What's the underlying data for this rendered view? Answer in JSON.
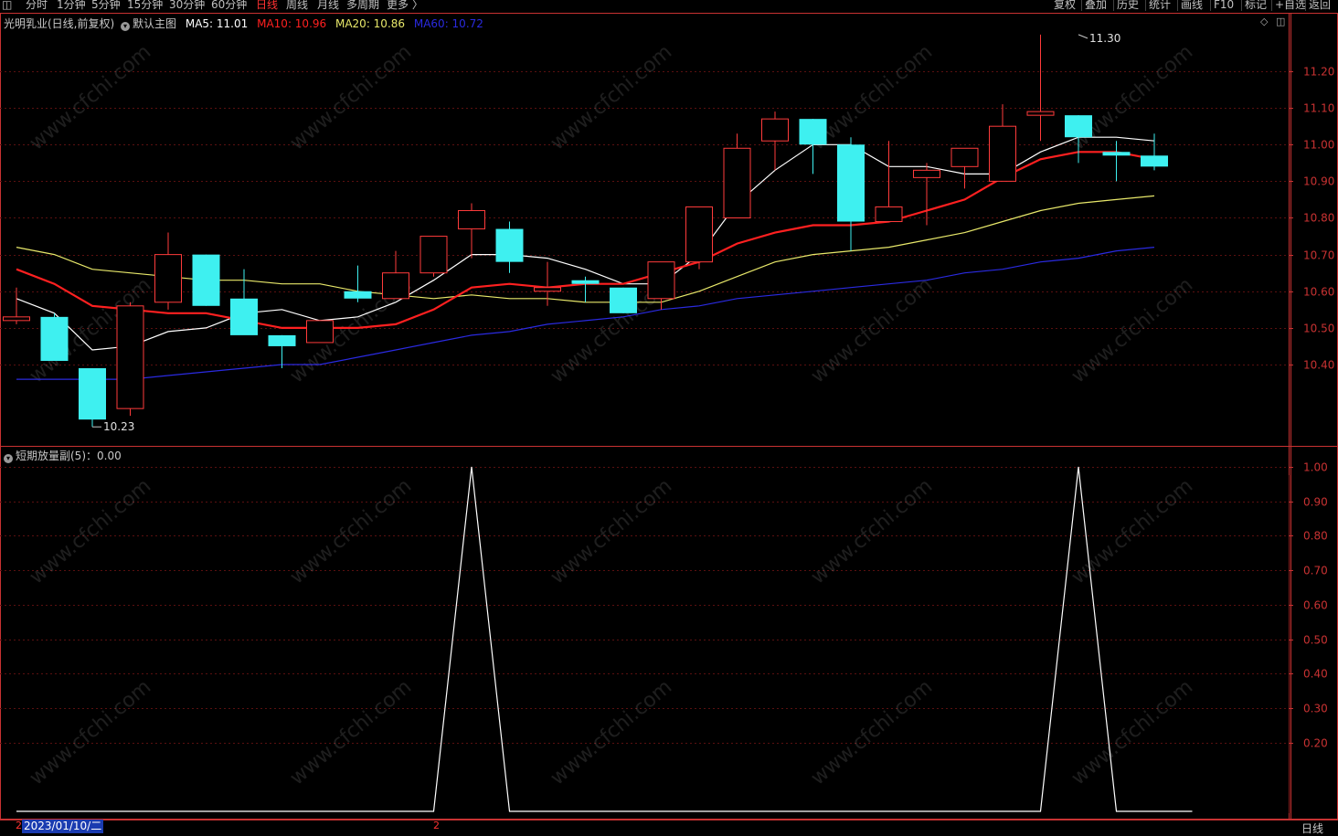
{
  "toolbar": {
    "periods": [
      "分时",
      "1分钟",
      "5分钟",
      "15分钟",
      "30分钟",
      "60分钟",
      "日线",
      "周线",
      "月线",
      "多周期",
      "更多 〉"
    ],
    "active_period": "日线",
    "right_buttons": [
      "复权",
      "叠加",
      "历史",
      "统计",
      "画线",
      "F10",
      "标记",
      "+自选",
      "返回"
    ]
  },
  "main_panel": {
    "stock_name": "光明乳业(日线,前复权)",
    "indicator": "默认主图",
    "ma5_label": "MA5: 11.01",
    "ma10_label": "MA10: 10.96",
    "ma20_label": "MA20: 10.86",
    "ma60_label": "MA60: 10.72",
    "colors": {
      "ma5": "#ffffff",
      "ma10": "#ff2020",
      "ma20": "#e8e86a",
      "ma60": "#2a2ae0",
      "up": "#ff3b3b",
      "down": "#3ef0f0",
      "axis": "#c83232"
    }
  },
  "sub_panel": {
    "indicator_label": "短期放量副(5)：0.00"
  },
  "footer": {
    "date": "2023/01/10/二",
    "mark_left": "2",
    "mark_mid": "2",
    "period_tab": "日线"
  },
  "chart_data": [
    {
      "type": "candlestick",
      "y_ticks": [
        10.4,
        10.5,
        10.6,
        10.7,
        10.8,
        10.9,
        11.0,
        11.1,
        11.2
      ],
      "ylim": [
        10.23,
        11.3
      ],
      "annotations": [
        {
          "label": "11.30",
          "value": 11.3,
          "index": 28
        },
        {
          "label": "10.23",
          "value": 10.23,
          "index": 2
        }
      ],
      "candles": [
        {
          "o": 10.52,
          "h": 10.61,
          "l": 10.51,
          "c": 10.53
        },
        {
          "o": 10.53,
          "h": 10.54,
          "l": 10.41,
          "c": 10.41
        },
        {
          "o": 10.39,
          "h": 10.39,
          "l": 10.23,
          "c": 10.25
        },
        {
          "o": 10.28,
          "h": 10.57,
          "l": 10.26,
          "c": 10.56
        },
        {
          "o": 10.57,
          "h": 10.76,
          "l": 10.55,
          "c": 10.7
        },
        {
          "o": 10.7,
          "h": 10.7,
          "l": 10.56,
          "c": 10.56
        },
        {
          "o": 10.58,
          "h": 10.66,
          "l": 10.5,
          "c": 10.48
        },
        {
          "o": 10.48,
          "h": 10.48,
          "l": 10.39,
          "c": 10.45
        },
        {
          "o": 10.46,
          "h": 10.52,
          "l": 10.46,
          "c": 10.52
        },
        {
          "o": 10.6,
          "h": 10.67,
          "l": 10.57,
          "c": 10.58
        },
        {
          "o": 10.58,
          "h": 10.71,
          "l": 10.58,
          "c": 10.65
        },
        {
          "o": 10.65,
          "h": 10.75,
          "l": 10.64,
          "c": 10.75
        },
        {
          "o": 10.77,
          "h": 10.84,
          "l": 10.69,
          "c": 10.82
        },
        {
          "o": 10.77,
          "h": 10.79,
          "l": 10.65,
          "c": 10.68
        },
        {
          "o": 10.6,
          "h": 10.68,
          "l": 10.56,
          "c": 10.61
        },
        {
          "o": 10.63,
          "h": 10.64,
          "l": 10.57,
          "c": 10.62
        },
        {
          "o": 10.61,
          "h": 10.61,
          "l": 10.54,
          "c": 10.54
        },
        {
          "o": 10.58,
          "h": 10.68,
          "l": 10.55,
          "c": 10.68
        },
        {
          "o": 10.68,
          "h": 10.83,
          "l": 10.66,
          "c": 10.83
        },
        {
          "o": 10.8,
          "h": 11.03,
          "l": 10.8,
          "c": 10.99
        },
        {
          "o": 11.01,
          "h": 11.09,
          "l": 10.93,
          "c": 11.07
        },
        {
          "o": 11.07,
          "h": 11.07,
          "l": 10.92,
          "c": 11.0
        },
        {
          "o": 11.0,
          "h": 11.02,
          "l": 10.71,
          "c": 10.79
        },
        {
          "o": 10.79,
          "h": 11.01,
          "l": 10.79,
          "c": 10.83
        },
        {
          "o": 10.91,
          "h": 10.95,
          "l": 10.78,
          "c": 10.93
        },
        {
          "o": 10.94,
          "h": 10.99,
          "l": 10.88,
          "c": 10.99
        },
        {
          "o": 10.9,
          "h": 11.11,
          "l": 10.9,
          "c": 11.05
        },
        {
          "o": 11.08,
          "h": 11.3,
          "l": 11.01,
          "c": 11.09
        },
        {
          "o": 11.08,
          "h": 11.08,
          "l": 10.95,
          "c": 11.02
        },
        {
          "o": 10.98,
          "h": 11.01,
          "l": 10.9,
          "c": 10.97
        },
        {
          "o": 10.97,
          "h": 11.03,
          "l": 10.93,
          "c": 10.94
        }
      ],
      "ma5": [
        10.58,
        10.54,
        10.44,
        10.45,
        10.49,
        10.5,
        10.54,
        10.55,
        10.52,
        10.53,
        10.57,
        10.63,
        10.7,
        10.7,
        10.69,
        10.66,
        10.62,
        10.62,
        10.7,
        10.84,
        10.93,
        11.0,
        11.0,
        10.94,
        10.94,
        10.92,
        10.92,
        10.98,
        11.02,
        11.02,
        11.01
      ],
      "ma10": [
        10.66,
        10.62,
        10.56,
        10.55,
        10.54,
        10.54,
        10.52,
        10.5,
        10.5,
        10.5,
        10.51,
        10.55,
        10.61,
        10.62,
        10.61,
        10.62,
        10.62,
        10.65,
        10.68,
        10.73,
        10.76,
        10.78,
        10.78,
        10.79,
        10.82,
        10.85,
        10.91,
        10.96,
        10.98,
        10.98,
        10.96
      ],
      "ma20": [
        10.72,
        10.7,
        10.66,
        10.65,
        10.64,
        10.63,
        10.63,
        10.62,
        10.62,
        10.6,
        10.59,
        10.58,
        10.59,
        10.58,
        10.58,
        10.57,
        10.57,
        10.57,
        10.6,
        10.64,
        10.68,
        10.7,
        10.71,
        10.72,
        10.74,
        10.76,
        10.79,
        10.82,
        10.84,
        10.85,
        10.86
      ],
      "ma60": [
        10.36,
        10.36,
        10.36,
        10.36,
        10.37,
        10.38,
        10.39,
        10.4,
        10.4,
        10.42,
        10.44,
        10.46,
        10.48,
        10.49,
        10.51,
        10.52,
        10.53,
        10.55,
        10.56,
        10.58,
        10.59,
        10.6,
        10.61,
        10.62,
        10.63,
        10.65,
        10.66,
        10.68,
        10.69,
        10.71,
        10.72
      ]
    },
    {
      "type": "line",
      "y_ticks": [
        0.2,
        0.3,
        0.4,
        0.5,
        0.6,
        0.7,
        0.8,
        0.9,
        1.0
      ],
      "ylim": [
        0,
        1.0
      ],
      "values": [
        0,
        0,
        0,
        0,
        0,
        0,
        0,
        0,
        0,
        0,
        0,
        0,
        1,
        0,
        0,
        0,
        0,
        0,
        0,
        0,
        0,
        0,
        0,
        0,
        0,
        0,
        0,
        0,
        1,
        0,
        0,
        0
      ]
    }
  ]
}
